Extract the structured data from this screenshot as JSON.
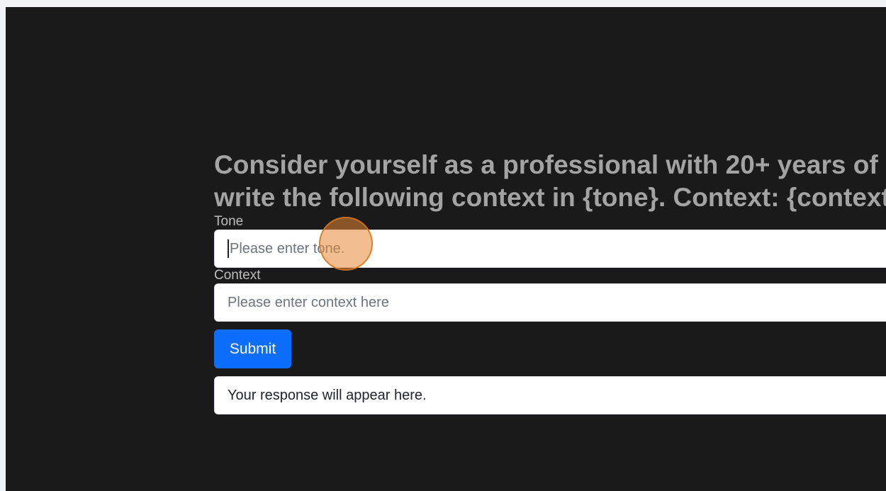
{
  "prompt": {
    "line1": "Consider yourself as a professional with 20+ years of",
    "line2": "write the following context in {tone}. Context: {context}"
  },
  "form": {
    "tone": {
      "label": "Tone",
      "placeholder": "Please enter tone."
    },
    "context": {
      "label": "Context",
      "placeholder": "Please enter context here"
    },
    "submit_label": "Submit",
    "response_text": "Your response will appear here."
  },
  "colors": {
    "background": "#1a1a1a",
    "title": "#a3a3a3",
    "submit": "#0d6efd",
    "click_marker": "#e88934"
  }
}
